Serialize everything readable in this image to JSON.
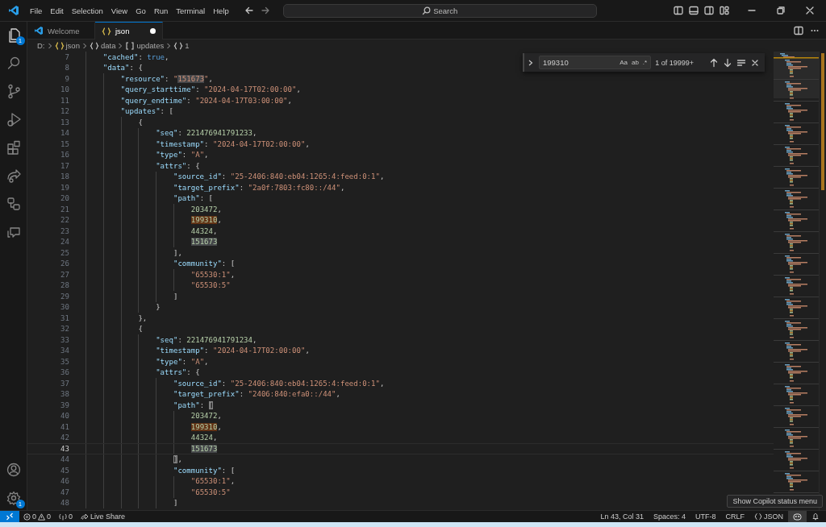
{
  "menu": [
    "File",
    "Edit",
    "Selection",
    "View",
    "Go",
    "Run",
    "Terminal",
    "Help"
  ],
  "search": {
    "placeholder": "Search"
  },
  "activity_bar": [
    {
      "kind": "explorer",
      "badge": "1"
    },
    {
      "kind": "search"
    },
    {
      "kind": "source-control"
    },
    {
      "kind": "run"
    },
    {
      "kind": "extensions"
    },
    {
      "kind": "live-share"
    },
    {
      "kind": "remote"
    },
    {
      "kind": "chat"
    }
  ],
  "activity_bar_bottom": [
    {
      "kind": "account"
    },
    {
      "kind": "settings",
      "badge": "1"
    }
  ],
  "tabs": [
    {
      "label": "Welcome",
      "kind": "welcome",
      "selected": false,
      "dirty": false
    },
    {
      "label": "json",
      "kind": "json",
      "selected": true,
      "dirty": true
    }
  ],
  "breadcrumbs": [
    {
      "label": "D:",
      "kind": "folder"
    },
    {
      "label": "json",
      "kind": "file"
    },
    {
      "label": "data",
      "kind": "object"
    },
    {
      "label": "updates",
      "kind": "array"
    },
    {
      "label": "1",
      "kind": "object"
    }
  ],
  "find": {
    "query": "199310",
    "options": [
      "Aa",
      "ab",
      ".*"
    ],
    "result": "1 of 19999+"
  },
  "editor": {
    "lines": [
      {
        "number": "7",
        "current": false,
        "tokens": [
          {
            "kind": "key",
            "text": "    \"cached\""
          },
          {
            "kind": "punct",
            "text": ": "
          },
          {
            "kind": "bool",
            "text": "true"
          },
          {
            "kind": "punct",
            "text": ","
          }
        ]
      },
      {
        "number": "8",
        "current": false,
        "tokens": [
          {
            "kind": "key",
            "text": "    \"data\""
          },
          {
            "kind": "punct",
            "text": ": {"
          }
        ]
      },
      {
        "number": "9",
        "current": false,
        "tokens": [
          {
            "kind": "key",
            "text": "        \"resource\""
          },
          {
            "kind": "punct",
            "text": ": "
          },
          {
            "kind": "string",
            "text": "\""
          },
          {
            "kind": "string",
            "text": "151673",
            "selection_match": true
          },
          {
            "kind": "string",
            "text": "\""
          },
          {
            "kind": "punct",
            "text": ","
          }
        ]
      },
      {
        "number": "10",
        "current": false,
        "tokens": [
          {
            "kind": "key",
            "text": "        \"query_starttime\""
          },
          {
            "kind": "punct",
            "text": ": "
          },
          {
            "kind": "string",
            "text": "\"2024-04-17T02:00:00\""
          },
          {
            "kind": "punct",
            "text": ","
          }
        ]
      },
      {
        "number": "11",
        "current": false,
        "tokens": [
          {
            "kind": "key",
            "text": "        \"query_endtime\""
          },
          {
            "kind": "punct",
            "text": ": "
          },
          {
            "kind": "string",
            "text": "\"2024-04-17T03:00:00\""
          },
          {
            "kind": "punct",
            "text": ","
          }
        ]
      },
      {
        "number": "12",
        "current": false,
        "tokens": [
          {
            "kind": "key",
            "text": "        \"updates\""
          },
          {
            "kind": "punct",
            "text": ": ["
          }
        ]
      },
      {
        "number": "13",
        "current": false,
        "tokens": [
          {
            "kind": "punct",
            "text": "            {"
          }
        ]
      },
      {
        "number": "14",
        "current": false,
        "tokens": [
          {
            "kind": "key",
            "text": "                \"seq\""
          },
          {
            "kind": "punct",
            "text": ": "
          },
          {
            "kind": "number",
            "text": "221476941791233"
          },
          {
            "kind": "punct",
            "text": ","
          }
        ]
      },
      {
        "number": "15",
        "current": false,
        "tokens": [
          {
            "kind": "key",
            "text": "                \"timestamp\""
          },
          {
            "kind": "punct",
            "text": ": "
          },
          {
            "kind": "string",
            "text": "\"2024-04-17T02:00:00\""
          },
          {
            "kind": "punct",
            "text": ","
          }
        ]
      },
      {
        "number": "16",
        "current": false,
        "tokens": [
          {
            "kind": "key",
            "text": "                \"type\""
          },
          {
            "kind": "punct",
            "text": ": "
          },
          {
            "kind": "string",
            "text": "\"A\""
          },
          {
            "kind": "punct",
            "text": ","
          }
        ]
      },
      {
        "number": "17",
        "current": false,
        "tokens": [
          {
            "kind": "key",
            "text": "                \"attrs\""
          },
          {
            "kind": "punct",
            "text": ": {"
          }
        ]
      },
      {
        "number": "18",
        "current": false,
        "tokens": [
          {
            "kind": "key",
            "text": "                    \"source_id\""
          },
          {
            "kind": "punct",
            "text": ": "
          },
          {
            "kind": "string",
            "text": "\"25-2406:840:eb04:1265:4:feed:0:1\""
          },
          {
            "kind": "punct",
            "text": ","
          }
        ]
      },
      {
        "number": "19",
        "current": false,
        "tokens": [
          {
            "kind": "key",
            "text": "                    \"target_prefix\""
          },
          {
            "kind": "punct",
            "text": ": "
          },
          {
            "kind": "string",
            "text": "\"2a0f:7803:fc80::/44\""
          },
          {
            "kind": "punct",
            "text": ","
          }
        ]
      },
      {
        "number": "20",
        "current": false,
        "tokens": [
          {
            "kind": "key",
            "text": "                    \"path\""
          },
          {
            "kind": "punct",
            "text": ": ["
          }
        ]
      },
      {
        "number": "21",
        "current": false,
        "tokens": [
          {
            "kind": "number",
            "text": "                        203472"
          },
          {
            "kind": "punct",
            "text": ","
          }
        ]
      },
      {
        "number": "22",
        "current": false,
        "tokens": [
          {
            "kind": "number",
            "text": "                        199310",
            "find_match": true
          },
          {
            "kind": "punct",
            "text": ","
          }
        ]
      },
      {
        "number": "23",
        "current": false,
        "tokens": [
          {
            "kind": "number",
            "text": "                        44324"
          },
          {
            "kind": "punct",
            "text": ","
          }
        ]
      },
      {
        "number": "24",
        "current": false,
        "tokens": [
          {
            "kind": "number",
            "text": "                        151673",
            "selection_match": true
          }
        ]
      },
      {
        "number": "25",
        "current": false,
        "tokens": [
          {
            "kind": "punct",
            "text": "                    ],"
          }
        ]
      },
      {
        "number": "26",
        "current": false,
        "tokens": [
          {
            "kind": "key",
            "text": "                    \"community\""
          },
          {
            "kind": "punct",
            "text": ": ["
          }
        ]
      },
      {
        "number": "27",
        "current": false,
        "tokens": [
          {
            "kind": "string",
            "text": "                        \"65530:1\""
          },
          {
            "kind": "punct",
            "text": ","
          }
        ]
      },
      {
        "number": "28",
        "current": false,
        "tokens": [
          {
            "kind": "string",
            "text": "                        \"65530:5\""
          }
        ]
      },
      {
        "number": "29",
        "current": false,
        "tokens": [
          {
            "kind": "punct",
            "text": "                    ]"
          }
        ]
      },
      {
        "number": "30",
        "current": false,
        "tokens": [
          {
            "kind": "punct",
            "text": "                }"
          }
        ]
      },
      {
        "number": "31",
        "current": false,
        "tokens": [
          {
            "kind": "punct",
            "text": "            },"
          }
        ]
      },
      {
        "number": "32",
        "current": false,
        "tokens": [
          {
            "kind": "punct",
            "text": "            {"
          }
        ]
      },
      {
        "number": "33",
        "current": false,
        "tokens": [
          {
            "kind": "key",
            "text": "                \"seq\""
          },
          {
            "kind": "punct",
            "text": ": "
          },
          {
            "kind": "number",
            "text": "221476941791234"
          },
          {
            "kind": "punct",
            "text": ","
          }
        ]
      },
      {
        "number": "34",
        "current": false,
        "tokens": [
          {
            "kind": "key",
            "text": "                \"timestamp\""
          },
          {
            "kind": "punct",
            "text": ": "
          },
          {
            "kind": "string",
            "text": "\"2024-04-17T02:00:00\""
          },
          {
            "kind": "punct",
            "text": ","
          }
        ]
      },
      {
        "number": "35",
        "current": false,
        "tokens": [
          {
            "kind": "key",
            "text": "                \"type\""
          },
          {
            "kind": "punct",
            "text": ": "
          },
          {
            "kind": "string",
            "text": "\"A\""
          },
          {
            "kind": "punct",
            "text": ","
          }
        ]
      },
      {
        "number": "36",
        "current": false,
        "tokens": [
          {
            "kind": "key",
            "text": "                \"attrs\""
          },
          {
            "kind": "punct",
            "text": ": {"
          }
        ]
      },
      {
        "number": "37",
        "current": false,
        "tokens": [
          {
            "kind": "key",
            "text": "                    \"source_id\""
          },
          {
            "kind": "punct",
            "text": ": "
          },
          {
            "kind": "string",
            "text": "\"25-2406:840:eb04:1265:4:feed:0:1\""
          },
          {
            "kind": "punct",
            "text": ","
          }
        ]
      },
      {
        "number": "38",
        "current": false,
        "tokens": [
          {
            "kind": "key",
            "text": "                    \"target_prefix\""
          },
          {
            "kind": "punct",
            "text": ": "
          },
          {
            "kind": "string",
            "text": "\"2406:840:efa0::/44\""
          },
          {
            "kind": "punct",
            "text": ","
          }
        ]
      },
      {
        "number": "39",
        "current": false,
        "tokens": [
          {
            "kind": "key",
            "text": "                    \"path\""
          },
          {
            "kind": "punct",
            "text": ": "
          },
          {
            "kind": "punct",
            "text": "[",
            "bracket_match": true
          }
        ]
      },
      {
        "number": "40",
        "current": false,
        "tokens": [
          {
            "kind": "number",
            "text": "                        203472"
          },
          {
            "kind": "punct",
            "text": ","
          }
        ]
      },
      {
        "number": "41",
        "current": false,
        "tokens": [
          {
            "kind": "number",
            "text": "                        199310",
            "find_match": true
          },
          {
            "kind": "punct",
            "text": ","
          }
        ]
      },
      {
        "number": "42",
        "current": false,
        "tokens": [
          {
            "kind": "number",
            "text": "                        44324"
          },
          {
            "kind": "punct",
            "text": ","
          }
        ]
      },
      {
        "number": "43",
        "current": true,
        "tokens": [
          {
            "kind": "number",
            "text": "                        151673",
            "selection_match": true
          }
        ]
      },
      {
        "number": "44",
        "current": false,
        "tokens": [
          {
            "kind": "punct",
            "text": "                    ]",
            "bracket_match": true
          },
          {
            "kind": "punct",
            "text": ","
          }
        ]
      },
      {
        "number": "45",
        "current": false,
        "tokens": [
          {
            "kind": "key",
            "text": "                    \"community\""
          },
          {
            "kind": "punct",
            "text": ": ["
          }
        ]
      },
      {
        "number": "46",
        "current": false,
        "tokens": [
          {
            "kind": "string",
            "text": "                        \"65530:1\""
          },
          {
            "kind": "punct",
            "text": ","
          }
        ]
      },
      {
        "number": "47",
        "current": false,
        "tokens": [
          {
            "kind": "string",
            "text": "                        \"65530:5\""
          }
        ]
      },
      {
        "number": "48",
        "current": false,
        "tokens": [
          {
            "kind": "punct",
            "text": "                    ]"
          }
        ]
      }
    ]
  },
  "tooltip": "Show Copilot status menu",
  "status_bar": {
    "left": [
      {
        "kind": "remote"
      },
      {
        "kind": "problems",
        "errors": "0",
        "warnings": "0"
      },
      {
        "kind": "ports",
        "text": "0"
      },
      {
        "kind": "live-share",
        "text": "Live Share"
      }
    ],
    "right": [
      {
        "kind": "text",
        "text": "Ln 43, Col 31"
      },
      {
        "kind": "text",
        "text": "Spaces: 4"
      },
      {
        "kind": "text",
        "text": "UTF-8"
      },
      {
        "kind": "text",
        "text": "CRLF"
      },
      {
        "kind": "language",
        "text": "JSON"
      },
      {
        "kind": "copilot"
      },
      {
        "kind": "bell"
      }
    ]
  }
}
